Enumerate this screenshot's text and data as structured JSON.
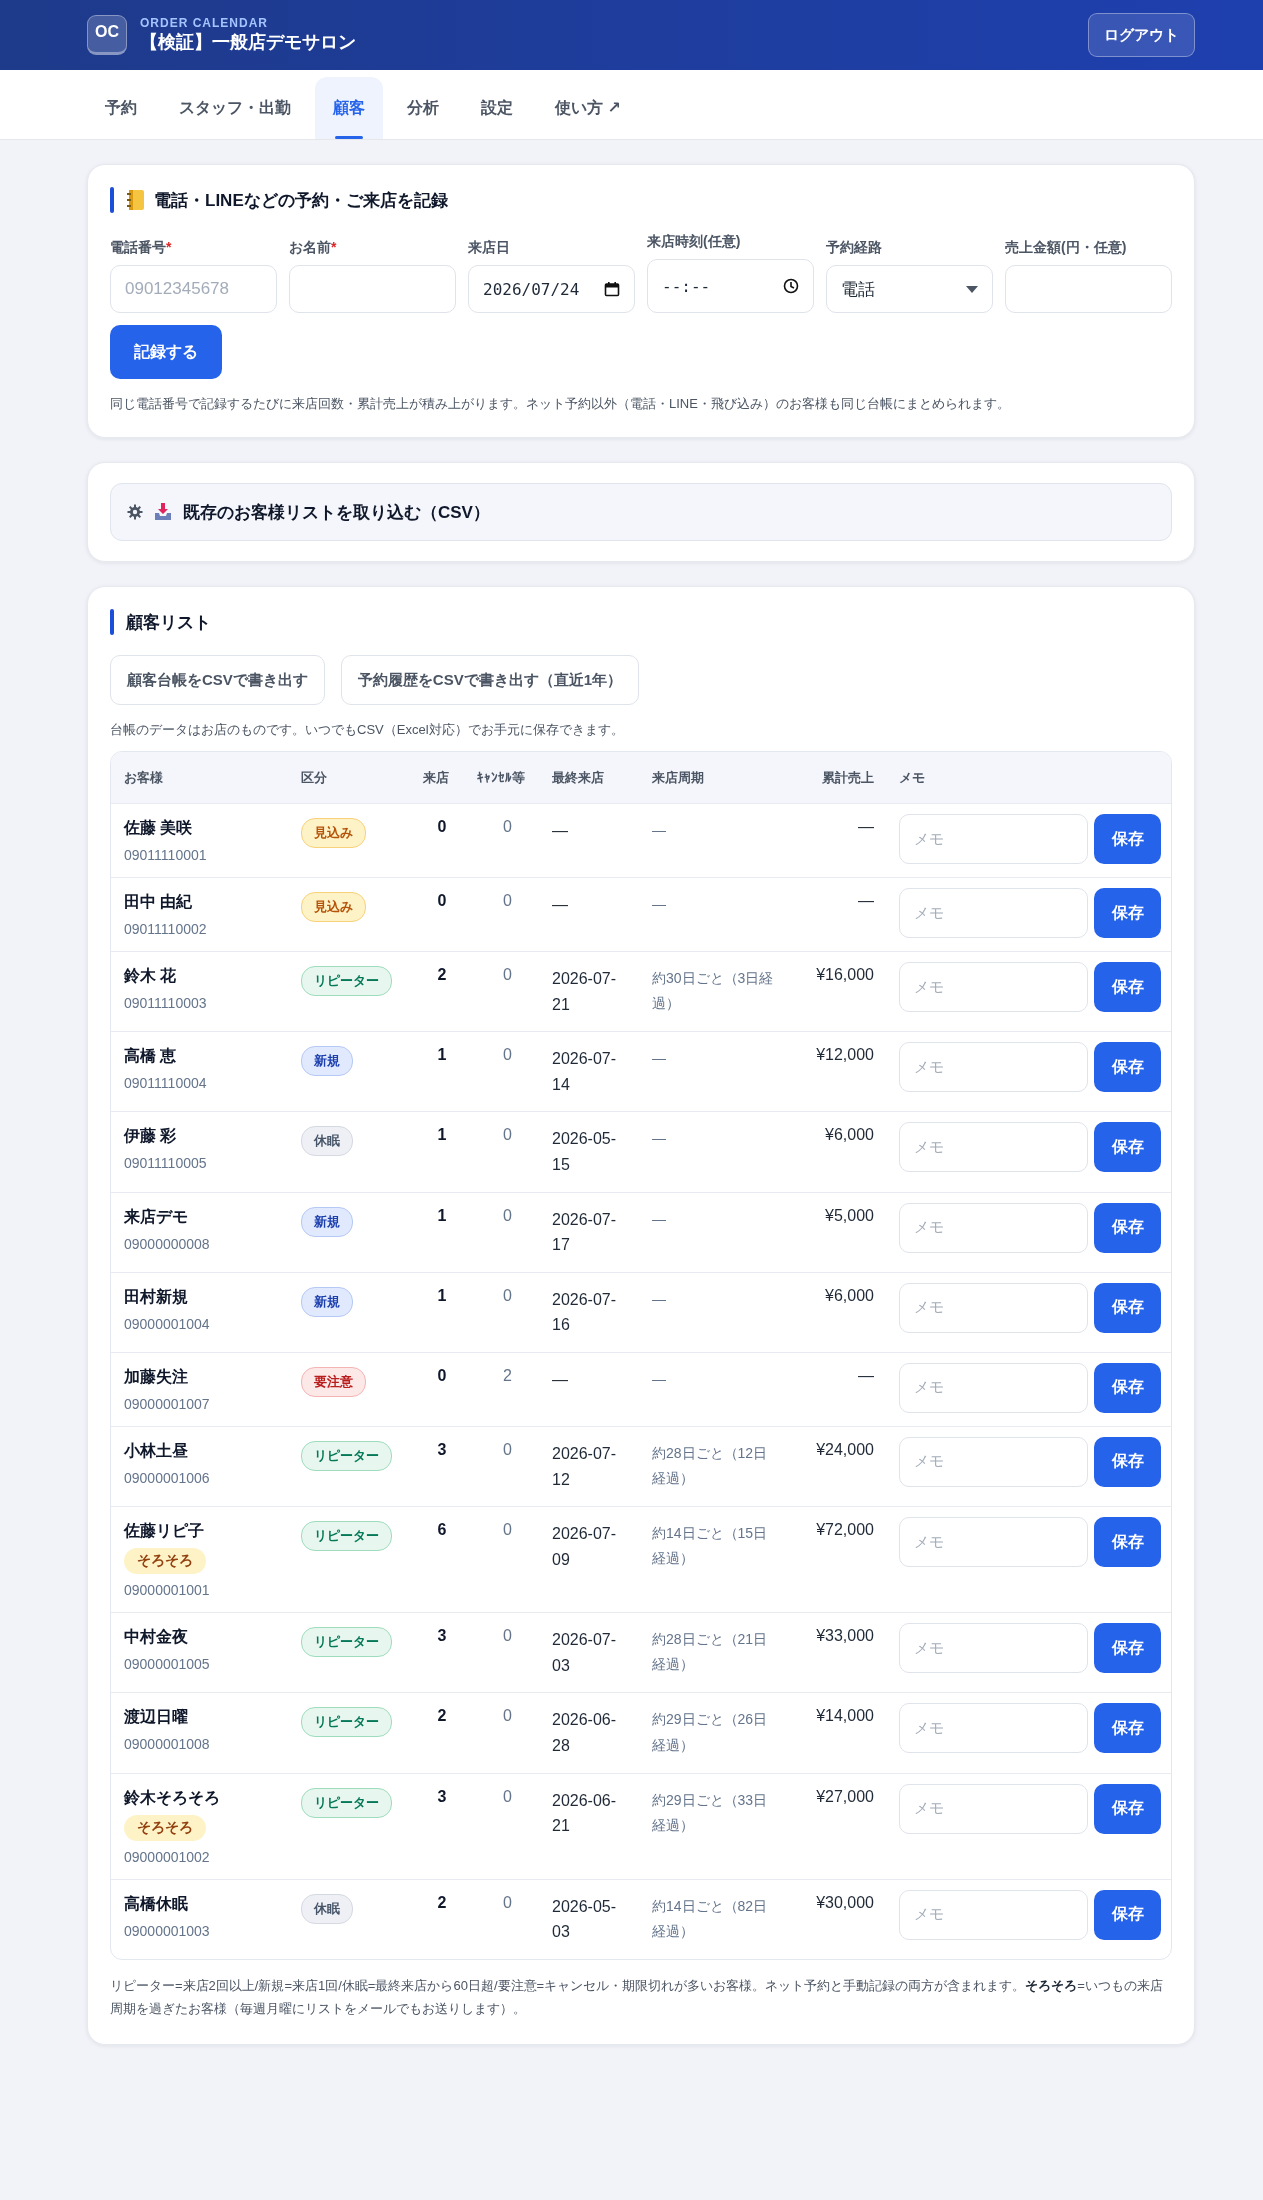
{
  "header": {
    "logo": "OC",
    "app_name": "ORDER CALENDAR",
    "shop_name": "【検証】一般店デモサロン",
    "logout": "ログアウト"
  },
  "tabs": [
    {
      "label": "予約",
      "selected": false
    },
    {
      "label": "スタッフ・出勤",
      "selected": false
    },
    {
      "label": "顧客",
      "selected": true
    },
    {
      "label": "分析",
      "selected": false
    },
    {
      "label": "設定",
      "selected": false
    },
    {
      "label": "使い方 ↗",
      "selected": false
    }
  ],
  "record_form": {
    "title": "電話・LINEなどの予約・ご来店を記録",
    "fields": [
      {
        "kind": "text",
        "label": "電話番号",
        "required_mark": "*",
        "placeholder": "09012345678"
      },
      {
        "kind": "text",
        "label": "お名前",
        "required_mark": "*"
      },
      {
        "kind": "date",
        "label": "来店日",
        "value": "2026/07/24"
      },
      {
        "kind": "time",
        "label": "来店時刻(任意)",
        "value": "--:--"
      },
      {
        "kind": "select",
        "label": "予約経路",
        "value": "電話"
      },
      {
        "kind": "text",
        "label": "売上金額(円・任意)"
      }
    ],
    "submit": "記録する",
    "note": "同じ電話番号で記録するたびに来店回数・累計売上が積み上がります。ネット予約以外（電話・LINE・飛び込み）のお客様も同じ台帳にまとめられます。"
  },
  "import": {
    "title": "既存のお客様リストを取り込む（CSV）",
    "expanded": false
  },
  "customer_list": {
    "title": "顧客リスト",
    "buttons": [
      "顧客台帳をCSVで書き出す",
      "予約履歴をCSVで書き出す（直近1年）"
    ],
    "note": "台帳のデータはお店のものです。いつでもCSV（Excel対応）でお手元に保存できます。",
    "columns": [
      "お客様",
      "区分",
      "来店",
      "ｷｬﾝｾﾙ等",
      "最終来店",
      "来店周期",
      "累計売上",
      "メモ"
    ],
    "rows": [
      {
        "name": "佐藤 美咲",
        "phone": "09011110001",
        "segment": {
          "kind": "prospect",
          "label": "見込み"
        },
        "visits": "0",
        "cancels": "0",
        "last_visit": "—",
        "cycle": "—",
        "sales": "—",
        "memo_placeholder": "メモ",
        "save": "保存"
      },
      {
        "name": "田中 由紀",
        "phone": "09011110002",
        "segment": {
          "kind": "prospect",
          "label": "見込み"
        },
        "visits": "0",
        "cancels": "0",
        "last_visit": "—",
        "cycle": "—",
        "sales": "—",
        "memo_placeholder": "メモ",
        "save": "保存"
      },
      {
        "name": "鈴木 花",
        "phone": "09011110003",
        "segment": {
          "kind": "repeater",
          "label": "リピーター"
        },
        "visits": "2",
        "cancels": "0",
        "last_visit": "2026-07-21",
        "cycle": "約30日ごと（3日経過）",
        "sales": "¥16,000",
        "memo_placeholder": "メモ",
        "save": "保存"
      },
      {
        "name": "高橋 恵",
        "phone": "09011110004",
        "segment": {
          "kind": "new",
          "label": "新規"
        },
        "visits": "1",
        "cancels": "0",
        "last_visit": "2026-07-14",
        "cycle": "—",
        "sales": "¥12,000",
        "memo_placeholder": "メモ",
        "save": "保存"
      },
      {
        "name": "伊藤 彩",
        "phone": "09011110005",
        "segment": {
          "kind": "dormant",
          "label": "休眠"
        },
        "visits": "1",
        "cancels": "0",
        "last_visit": "2026-05-15",
        "cycle": "—",
        "sales": "¥6,000",
        "memo_placeholder": "メモ",
        "save": "保存"
      },
      {
        "name": "来店デモ",
        "phone": "09000000008",
        "segment": {
          "kind": "new",
          "label": "新規"
        },
        "visits": "1",
        "cancels": "0",
        "last_visit": "2026-07-17",
        "cycle": "—",
        "sales": "¥5,000",
        "memo_placeholder": "メモ",
        "save": "保存"
      },
      {
        "name": "田村新規",
        "phone": "09000001004",
        "segment": {
          "kind": "new",
          "label": "新規"
        },
        "visits": "1",
        "cancels": "0",
        "last_visit": "2026-07-16",
        "cycle": "—",
        "sales": "¥6,000",
        "memo_placeholder": "メモ",
        "save": "保存"
      },
      {
        "name": "加藤失注",
        "phone": "09000001007",
        "segment": {
          "kind": "caution",
          "label": "要注意"
        },
        "visits": "0",
        "cancels": "2",
        "last_visit": "—",
        "cycle": "—",
        "sales": "—",
        "memo_placeholder": "メモ",
        "save": "保存"
      },
      {
        "name": "小林土昼",
        "phone": "09000001006",
        "segment": {
          "kind": "repeater",
          "label": "リピーター"
        },
        "visits": "3",
        "cancels": "0",
        "last_visit": "2026-07-12",
        "cycle": "約28日ごと（12日経過）",
        "sales": "¥24,000",
        "memo_placeholder": "メモ",
        "save": "保存"
      },
      {
        "name": "佐藤リピ子",
        "tag": "そろそろ",
        "phone": "09000001001",
        "segment": {
          "kind": "repeater",
          "label": "リピーター"
        },
        "visits": "6",
        "cancels": "0",
        "last_visit": "2026-07-09",
        "cycle": "約14日ごと（15日経過）",
        "sales": "¥72,000",
        "memo_placeholder": "メモ",
        "save": "保存"
      },
      {
        "name": "中村金夜",
        "phone": "09000001005",
        "segment": {
          "kind": "repeater",
          "label": "リピーター"
        },
        "visits": "3",
        "cancels": "0",
        "last_visit": "2026-07-03",
        "cycle": "約28日ごと（21日経過）",
        "sales": "¥33,000",
        "memo_placeholder": "メモ",
        "save": "保存"
      },
      {
        "name": "渡辺日曜",
        "phone": "09000001008",
        "segment": {
          "kind": "repeater",
          "label": "リピーター"
        },
        "visits": "2",
        "cancels": "0",
        "last_visit": "2026-06-28",
        "cycle": "約29日ごと（26日経過）",
        "sales": "¥14,000",
        "memo_placeholder": "メモ",
        "save": "保存"
      },
      {
        "name": "鈴木そろそろ",
        "tag": "そろそろ",
        "phone": "09000001002",
        "segment": {
          "kind": "repeater",
          "label": "リピーター"
        },
        "visits": "3",
        "cancels": "0",
        "last_visit": "2026-06-21",
        "cycle": "約29日ごと（33日経過）",
        "sales": "¥27,000",
        "memo_placeholder": "メモ",
        "save": "保存"
      },
      {
        "name": "高橋休眠",
        "phone": "09000001003",
        "segment": {
          "kind": "dormant",
          "label": "休眠"
        },
        "visits": "2",
        "cancels": "0",
        "last_visit": "2026-05-03",
        "cycle": "約14日ごと（82日経過）",
        "sales": "¥30,000",
        "memo_placeholder": "メモ",
        "save": "保存"
      }
    ],
    "footnote": "リピーター=来店2回以上/新規=来店1回/休眠=最終来店から60日超/要注意=キャンセル・期限切れが多いお客様。ネット予約と手動記録の両方が含まれます。**そろそろ**=いつもの来店周期を過ぎたお客様（毎週月曜にリストをメールでもお送りします）。"
  }
}
